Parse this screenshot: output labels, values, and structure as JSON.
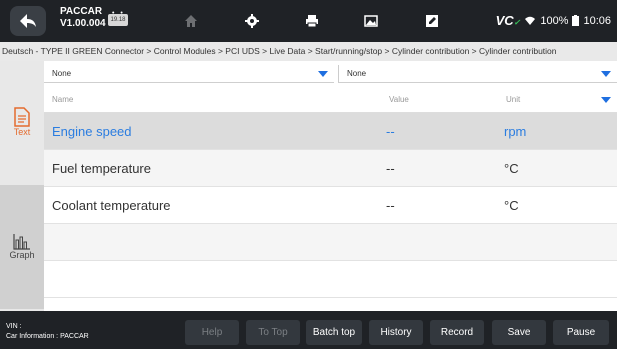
{
  "header": {
    "title_line1": "PACCAR",
    "title_line2": "V1.00.004",
    "vci_badge": "19.18",
    "icons": [
      "home-icon",
      "gear-icon",
      "printer-icon",
      "image-icon",
      "edit-icon"
    ],
    "status": {
      "vci": "VC",
      "battery": "100%",
      "time": "10:06"
    }
  },
  "breadcrumb": "Deutsch - TYPE II GREEN Connector > Control Modules > PCI UDS > Live Data > Start/running/stop > Cylinder contribution > Cylinder contribution",
  "sidebar": {
    "text_label": "Text",
    "graph_label": "Graph"
  },
  "selectors": {
    "left_value": "None",
    "right_value": "None"
  },
  "table": {
    "headers": {
      "name": "Name",
      "value": "Value",
      "unit": "Unit"
    },
    "rows": [
      {
        "name": "Engine speed",
        "value": "--",
        "unit": "rpm"
      },
      {
        "name": "Fuel temperature",
        "value": "--",
        "unit": "°C"
      },
      {
        "name": "Coolant temperature",
        "value": "--",
        "unit": "°C"
      }
    ]
  },
  "footer": {
    "vin_label": "VIN :",
    "car_info": "Car Information : PACCAR",
    "buttons": {
      "help": "Help",
      "to_top": "To Top",
      "batch_top": "Batch top",
      "history": "History",
      "record": "Record",
      "save": "Save",
      "pause": "Pause"
    }
  }
}
